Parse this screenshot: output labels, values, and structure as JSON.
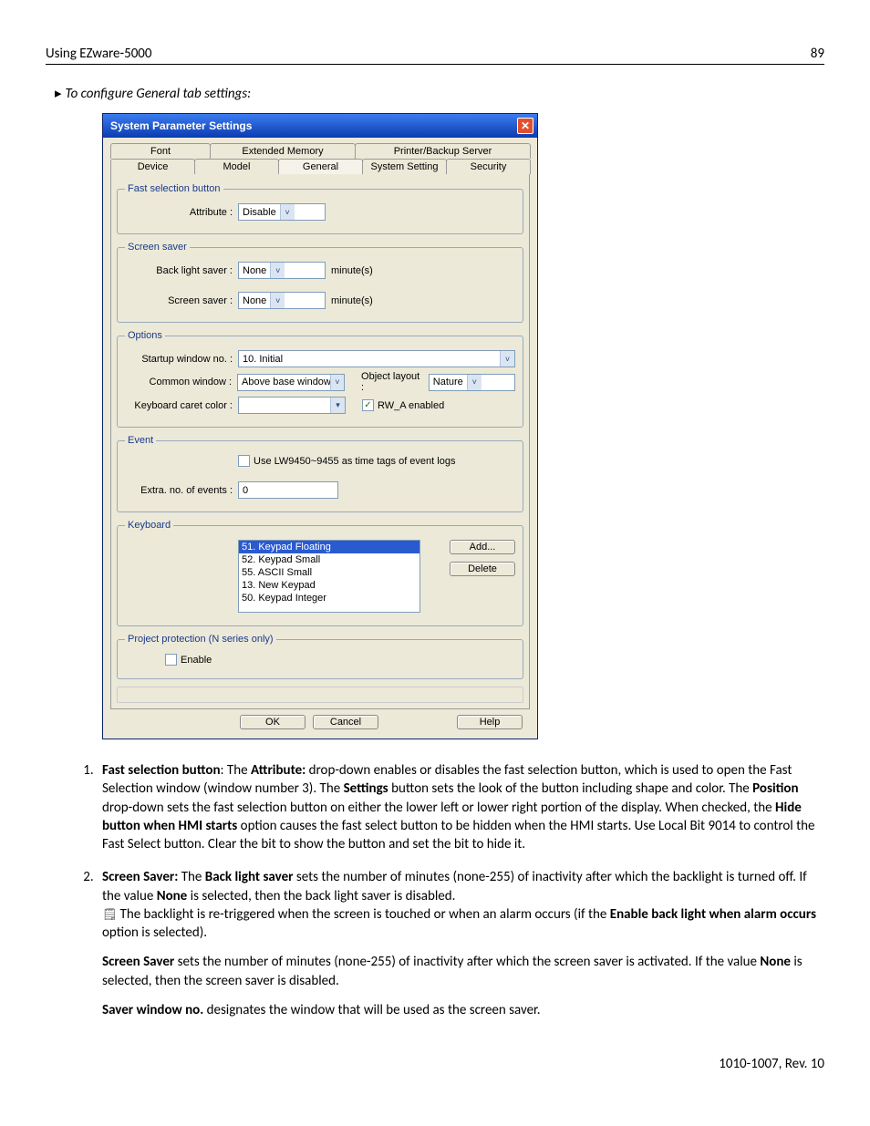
{
  "header": {
    "title": "Using EZware-5000",
    "page": "89"
  },
  "instruction": "To configure General tab settings:",
  "dialog": {
    "title": "System Parameter Settings",
    "tabs_top": [
      "Font",
      "Extended Memory",
      "Printer/Backup Server"
    ],
    "tabs_bottom": [
      "Device",
      "Model",
      "General",
      "System Setting",
      "Security"
    ],
    "fast_selection": {
      "legend": "Fast selection button",
      "attribute_label": "Attribute :",
      "attribute_value": "Disable"
    },
    "screen_saver": {
      "legend": "Screen saver",
      "backlight_label": "Back light saver :",
      "backlight_value": "None",
      "screensaver_label": "Screen saver :",
      "screensaver_value": "None",
      "unit": "minute(s)"
    },
    "options": {
      "legend": "Options",
      "startup_label": "Startup window no. :",
      "startup_value": "10. Initial",
      "common_label": "Common window :",
      "common_value": "Above base window",
      "layout_label": "Object layout :",
      "layout_value": "Nature",
      "caret_label": "Keyboard caret color :",
      "rw_label": "RW_A enabled"
    },
    "event": {
      "legend": "Event",
      "use_lw_label": "Use LW9450~9455 as time tags of event logs",
      "extra_label": "Extra. no. of events :",
      "extra_value": "0"
    },
    "keyboard": {
      "legend": "Keyboard",
      "items": [
        "51. Keypad Floating",
        "52. Keypad Small",
        "55. ASCII Small",
        "13. New Keypad",
        "50. Keypad Integer"
      ],
      "add": "Add...",
      "delete": "Delete"
    },
    "protection": {
      "legend": "Project protection (N series only)",
      "enable": "Enable"
    },
    "buttons": {
      "ok": "OK",
      "cancel": "Cancel",
      "help": "Help"
    }
  },
  "list": {
    "item1": {
      "lead": "Fast selection button",
      "t1": ": The ",
      "attr": "Attribute:",
      "t2": " drop-down enables or disables the fast selection button, which is used to open the Fast Selection window (window number 3). The ",
      "settings": "Settings",
      "t3": " button sets the look of the button including shape and color. The ",
      "position": "Position",
      "t4": " drop-down sets the fast selection button on either the lower left or lower right portion of the display. When checked, the ",
      "hide": "Hide button when HMI starts",
      "t5": " option causes the fast select button to be hidden when the HMI starts. Use Local Bit 9014 to control the Fast Select button. Clear the bit to show the button and set the bit to hide it."
    },
    "item2": {
      "lead": "Screen Saver:",
      "t1": " The ",
      "bls": "Back light saver",
      "t2": " sets the number of minutes (none-255) of inactivity after which the backlight is turned off. If the value ",
      "none": "None",
      "t3": " is selected, then the back light saver is disabled.",
      "note_pre": "The backlight is re-triggered when the screen is touched or when an alarm occurs (if the ",
      "ebl": "Enable back light when alarm occurs",
      "note_post": " option is selected).",
      "p2_lead": "Screen Saver",
      "p2_t1": " sets the number of minutes (none-255) of inactivity after which the screen saver is activated. If the value ",
      "p2_none": "None",
      "p2_t2": " is selected, then the screen saver is disabled.",
      "p3_lead": "Saver window no.",
      "p3_t": " designates the window that will be used as the screen saver."
    }
  },
  "footer": "1010-1007, Rev. 10"
}
